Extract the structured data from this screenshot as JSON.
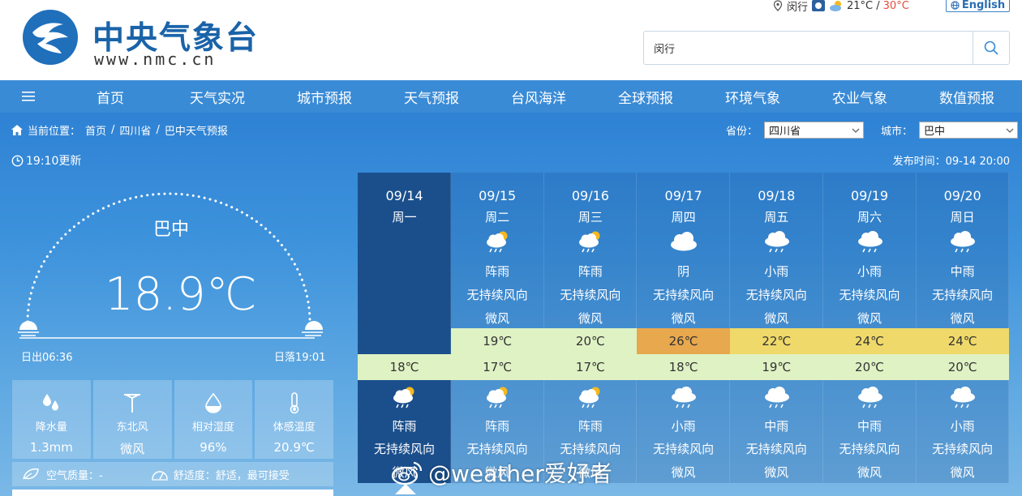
{
  "header": {
    "logo_cn": "中央气象台",
    "logo_url": "www.nmc.cn",
    "location": "闵行",
    "temp_range_low": "21°C / ",
    "temp_range_high": "30°C",
    "english_label": "English",
    "search_value": "闵行"
  },
  "nav": [
    "首页",
    "天气实况",
    "城市预报",
    "天气预报",
    "台风海洋",
    "全球预报",
    "环境气象",
    "农业气象",
    "数值预报"
  ],
  "breadcrumb": {
    "prefix": "当前位置：",
    "items": [
      "首页",
      "四川省",
      "巴中天气预报"
    ],
    "sep": "/"
  },
  "selectors": {
    "province_label": "省份：",
    "province_value": "四川省",
    "city_label": "城市：",
    "city_value": "巴中"
  },
  "update_time": "19:10更新",
  "publish_time": "发布时间：09-14 20:00",
  "current": {
    "city": "巴中",
    "temp": "18.9℃",
    "sunrise": "日出06:36",
    "sunset": "日落19:01"
  },
  "stats": [
    {
      "icon": "raindrops-icon",
      "label": "降水量",
      "value": "1.3mm"
    },
    {
      "icon": "windmill-icon",
      "label": "东北风",
      "value": "微风"
    },
    {
      "icon": "humidity-icon",
      "label": "相对湿度",
      "value": "96%"
    },
    {
      "icon": "thermometer-icon",
      "label": "体感温度",
      "value": "20.9℃"
    }
  ],
  "air": {
    "aq_label": "空气质量：-",
    "comfort_label": "舒适度：舒适，最可接受"
  },
  "forecast": [
    {
      "date": "09/14",
      "week": "周一",
      "day_weather": "",
      "day_wind_dir": "",
      "day_wind_power": "",
      "high": "",
      "high_color": "",
      "low": "18℃",
      "night_icon": "partly-rain",
      "night_weather": "阵雨",
      "night_wind_dir": "无持续风向",
      "night_wind_power": "微风",
      "today": true
    },
    {
      "date": "09/15",
      "week": "周二",
      "day_icon": "partly-rain",
      "day_weather": "阵雨",
      "day_wind_dir": "无持续风向",
      "day_wind_power": "微风",
      "high": "19℃",
      "high_color": "#dff2c4",
      "low": "17℃",
      "night_icon": "partly-rain",
      "night_weather": "阵雨",
      "night_wind_dir": "无持续风向",
      "night_wind_power": "微风"
    },
    {
      "date": "09/16",
      "week": "周三",
      "day_icon": "partly-rain",
      "day_weather": "阵雨",
      "day_wind_dir": "无持续风向",
      "day_wind_power": "微风",
      "high": "20℃",
      "high_color": "#dff2c4",
      "low": "17℃",
      "night_icon": "partly-rain",
      "night_weather": "阵雨",
      "night_wind_dir": "无持续风向",
      "night_wind_power": "微风"
    },
    {
      "date": "09/17",
      "week": "周四",
      "day_icon": "cloud",
      "day_weather": "阴",
      "day_wind_dir": "无持续风向",
      "day_wind_power": "微风",
      "high": "26℃",
      "high_color": "#e8a84e",
      "low": "18℃",
      "night_icon": "rain",
      "night_weather": "小雨",
      "night_wind_dir": "无持续风向",
      "night_wind_power": "微风"
    },
    {
      "date": "09/18",
      "week": "周五",
      "day_icon": "rain",
      "day_weather": "小雨",
      "day_wind_dir": "无持续风向",
      "day_wind_power": "微风",
      "high": "22℃",
      "high_color": "#efd96a",
      "low": "19℃",
      "night_icon": "rain",
      "night_weather": "中雨",
      "night_wind_dir": "无持续风向",
      "night_wind_power": "微风"
    },
    {
      "date": "09/19",
      "week": "周六",
      "day_icon": "rain",
      "day_weather": "小雨",
      "day_wind_dir": "无持续风向",
      "day_wind_power": "微风",
      "high": "24℃",
      "high_color": "#efd96a",
      "low": "20℃",
      "night_icon": "rain",
      "night_weather": "中雨",
      "night_wind_dir": "无持续风向",
      "night_wind_power": "微风"
    },
    {
      "date": "09/20",
      "week": "周日",
      "day_icon": "rain",
      "day_weather": "中雨",
      "day_wind_dir": "无持续风向",
      "day_wind_power": "微风",
      "high": "24℃",
      "high_color": "#efd96a",
      "low": "20℃",
      "night_icon": "rain",
      "night_weather": "小雨",
      "night_wind_dir": "无持续风向",
      "night_wind_power": "微风"
    }
  ],
  "watermark": "@weather爱好者"
}
